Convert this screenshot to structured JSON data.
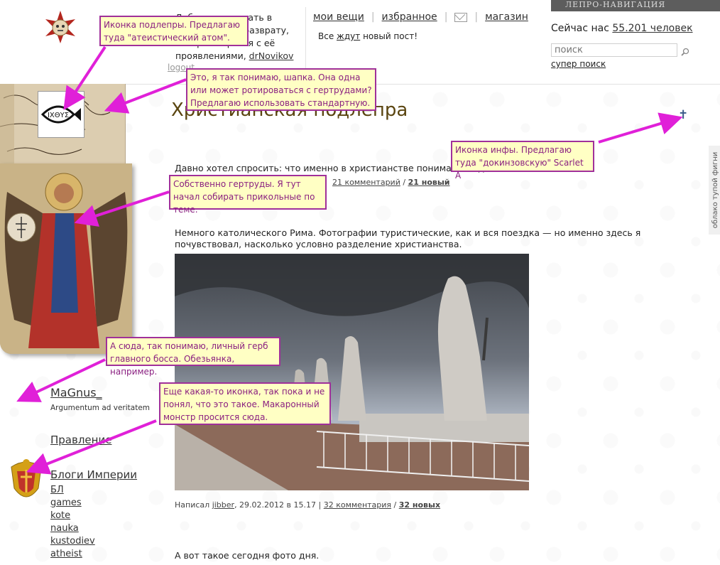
{
  "header": {
    "welcome_line1": "Добро пожаловать в",
    "welcome_line2": "обитель зла и разврату,",
    "welcome_line3": "которое борется с её",
    "welcome_line4": "проявлениями,",
    "welcome_user": "drNovikov",
    "logout": "logout",
    "nav": {
      "my_things": "мои вещи",
      "favorites": "избранное",
      "shop": "магазин"
    },
    "waiting_prefix": "Все",
    "waiting_link": "ждут",
    "waiting_suffix": "новый пост!",
    "lepro_nav": "ЛЕПРО-НАВИГАЦИЯ",
    "online_prefix": "Сейчас нас",
    "online_count": "55.201 человек",
    "search_placeholder": "поиск",
    "super_search": "супер поиск"
  },
  "sidebar": {
    "user_name": "MaGnus_",
    "user_motto": "Argumentum ad veritatem",
    "board": "Правление",
    "blogs_title": "Блоги Империи",
    "blogs": [
      "БЛ",
      "games",
      "kote",
      "nauka",
      "kustodiev",
      "atheist"
    ]
  },
  "main": {
    "title": "Христианская подлепра",
    "info_icon": "✝",
    "cloud_tab": "облако тупой фигни",
    "post1": {
      "text": "Давно хотел спросить: что именно в христианстве понимают под",
      "comments": "21 комментарий",
      "new": "21 новый",
      "sep": "/"
    },
    "post2": {
      "text": "Немного католического Рима. Фотографии туристические, как и вся поездка — но именно здесь я почувствовал, насколько условно разделение христианства.",
      "written_by": "Написал",
      "author": "jibber",
      "date": ", 29.02.2012 в 15.17 |",
      "comments": "32 комментария",
      "sep": "/",
      "new": "32 новых"
    },
    "post3": {
      "text": "А вот такое сегодня фото дня."
    }
  },
  "annotations": {
    "a1": "Иконка подлепры. Предлагаю туда \"атеистический атом\".",
    "a2": "Это, я так понимаю, шапка. Она одна или может ротироваться с гертрудами? Предлагаю использовать стандартную.",
    "a3": "Иконка инфы. Предлагаю туда \"докинзовскую\" Scarlet A",
    "a4": "Собственно гертруды. Я тут начал собирать прикольные по теме.",
    "a5": "А сюда, так понимаю, личный герб главного босса. Обезьянка, например.",
    "a6": "Еще какая-то иконка, так пока и не понял, что это такое. Макаронный монстр просится сюда."
  },
  "colors": {
    "annotation_border": "#a0309a",
    "annotation_bg": "#ffffc4",
    "title": "#5a4510"
  }
}
